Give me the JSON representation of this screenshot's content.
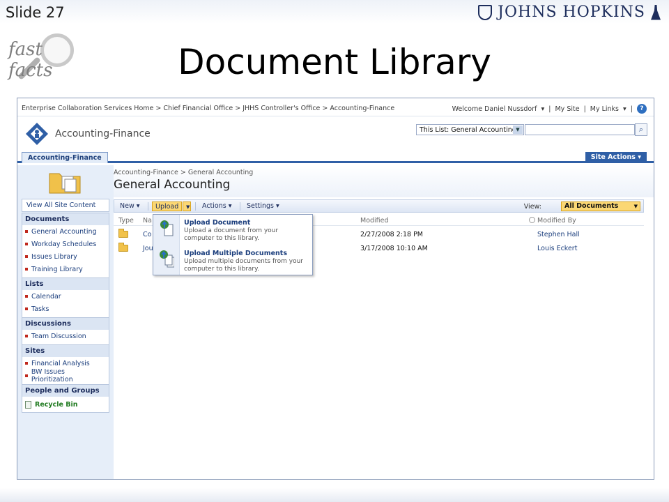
{
  "slide": {
    "number_label": "Slide 27",
    "title": "Document Library",
    "brand": "JOHNS HOPKINS",
    "badge": "fast facts"
  },
  "top": {
    "breadcrumb": "Enterprise Collaboration Services Home > Chief Financial Office > JHHS Controller's Office > Accounting-Finance",
    "welcome": "Welcome Daniel Nussdorf",
    "my_site": "My Site",
    "my_links": "My Links"
  },
  "site": {
    "title": "Accounting-Finance",
    "scope": "This List: General Accounting",
    "search_placeholder": "",
    "tab": "Accounting-Finance",
    "site_actions": "Site Actions"
  },
  "nav": {
    "view_all": "View All Site Content",
    "sections": [
      {
        "head": "Documents",
        "items": [
          "General Accounting",
          "Workday Schedules",
          "Issues Library",
          "Training Library"
        ]
      },
      {
        "head": "Lists",
        "items": [
          "Calendar",
          "Tasks"
        ]
      },
      {
        "head": "Discussions",
        "items": [
          "Team Discussion"
        ]
      },
      {
        "head": "Sites",
        "items": [
          "Financial Analysis",
          "BW Issues Prioritization"
        ]
      },
      {
        "head": "People and Groups",
        "items": []
      }
    ],
    "recycle": "Recycle Bin"
  },
  "page": {
    "breadcrumb": "Accounting-Finance > General Accounting",
    "title": "General Accounting"
  },
  "toolbar": {
    "new": "New",
    "upload": "Upload",
    "actions": "Actions",
    "settings": "Settings",
    "view_label": "View:",
    "view_value": "All Documents"
  },
  "columns": {
    "type": "Type",
    "name": "Na",
    "modified": "Modified",
    "modified_by": "Modified By"
  },
  "rows": [
    {
      "name": "Co",
      "modified": "2/27/2008 2:18 PM",
      "modified_by": "Stephen Hall"
    },
    {
      "name": "Jou",
      "modified": "3/17/2008 10:10 AM",
      "modified_by": "Louis Eckert"
    }
  ],
  "upload_menu": [
    {
      "title": "Upload Document",
      "desc": "Upload a document from your computer to this library."
    },
    {
      "title": "Upload Multiple Documents",
      "desc": "Upload multiple documents from your computer to this library."
    }
  ]
}
